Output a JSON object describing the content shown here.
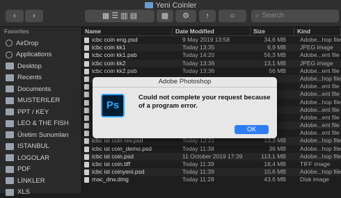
{
  "window": {
    "title": "Yeni Coinler"
  },
  "toolbar": {
    "view_label": "⚙",
    "search_placeholder": "Search"
  },
  "sidebar": {
    "heading": "Favorites",
    "items": [
      {
        "label": "AirDrop",
        "icon": "airdrop-icon"
      },
      {
        "label": "Applications",
        "icon": "applications-icon"
      },
      {
        "label": "Desktop",
        "icon": "folder-icon"
      },
      {
        "label": "Recents",
        "icon": "folder-icon"
      },
      {
        "label": "Documents",
        "icon": "folder-icon"
      },
      {
        "label": "MUSTERILER",
        "icon": "folder-icon"
      },
      {
        "label": "PPT / KEY",
        "icon": "folder-icon"
      },
      {
        "label": "LEO & THE FISH",
        "icon": "folder-icon"
      },
      {
        "label": "Üretim Sunumları",
        "icon": "folder-icon"
      },
      {
        "label": "ISTANBUL",
        "icon": "folder-icon"
      },
      {
        "label": "LOGOLAR",
        "icon": "folder-icon"
      },
      {
        "label": "PDF",
        "icon": "folder-icon"
      },
      {
        "label": "LİNKLER",
        "icon": "folder-icon"
      },
      {
        "label": "XLS",
        "icon": "folder-icon"
      }
    ]
  },
  "table": {
    "columns": [
      "Name",
      "Date Modified",
      "Size",
      "Kind"
    ],
    "rows": [
      {
        "name": "icbc coin eng.psd",
        "date": "9 May 2019 13:58",
        "size": "34,6 MB",
        "kind": "Adobe...hop file"
      },
      {
        "name": "icbc coin kk1",
        "date": "Today 13:35",
        "size": "6,9 MB",
        "kind": "JPEG image"
      },
      {
        "name": "icbc coin kk1.psb",
        "date": "Today 14:20",
        "size": "56,3 MB",
        "kind": "Adobe...ent file"
      },
      {
        "name": "icbc coin kk2",
        "date": "Today 13:36",
        "size": "13,1 MB",
        "kind": "JPEG image"
      },
      {
        "name": "icbc coin kk2.psb",
        "date": "Today 13:36",
        "size": "56 MB",
        "kind": "Adobe...ent file"
      },
      {
        "name": "",
        "date": "",
        "size": "",
        "kind": "Adobe...hop file"
      },
      {
        "name": "",
        "date": "",
        "size": "",
        "kind": "Adobe...ent file"
      },
      {
        "name": "",
        "date": "",
        "size": "",
        "kind": "Adobe...ent file"
      },
      {
        "name": "",
        "date": "",
        "size": "",
        "kind": "Adobe...hop file"
      },
      {
        "name": "",
        "date": "",
        "size": "",
        "kind": "Adobe...ent file"
      },
      {
        "name": "",
        "date": "",
        "size": "",
        "kind": "Adobe...ent file"
      },
      {
        "name": "",
        "date": "",
        "size": "",
        "kind": "Adobe...ent file"
      },
      {
        "name": "",
        "date": "",
        "size": "",
        "kind": "Adobe...ent file"
      },
      {
        "name": "icbc ist coin rev.psd",
        "date": "Today 12:21",
        "size": "13,3 MB",
        "kind": "Adobe...hop file"
      },
      {
        "name": "icbc ist coin_demo.psd",
        "date": "Today 11:38",
        "size": "36 MB",
        "kind": "Adobe...hop file"
      },
      {
        "name": "icbc ist coin.psd",
        "date": "11 October 2019 17:39",
        "size": "113,1 MB",
        "kind": "Adobe...hop file"
      },
      {
        "name": "icbc ist coin.tiff",
        "date": "Today 11:39",
        "size": "18,4 MB",
        "kind": "TIFF image"
      },
      {
        "name": "icbc ist coinyeni.psd",
        "date": "Today 11:39",
        "size": "10,6 MB",
        "kind": "Adobe...hop file"
      },
      {
        "name": "mac_drw.dmg",
        "date": "Today 11:28",
        "size": "43,6 MB",
        "kind": "Disk image"
      }
    ]
  },
  "dialog": {
    "title": "Adobe Photoshop",
    "icon_text": "Ps",
    "message": "Could not complete your request because of a program error.",
    "ok_label": "OK"
  },
  "colors": {
    "accent": "#2f7df6",
    "ps_blue": "#31a8ff"
  }
}
